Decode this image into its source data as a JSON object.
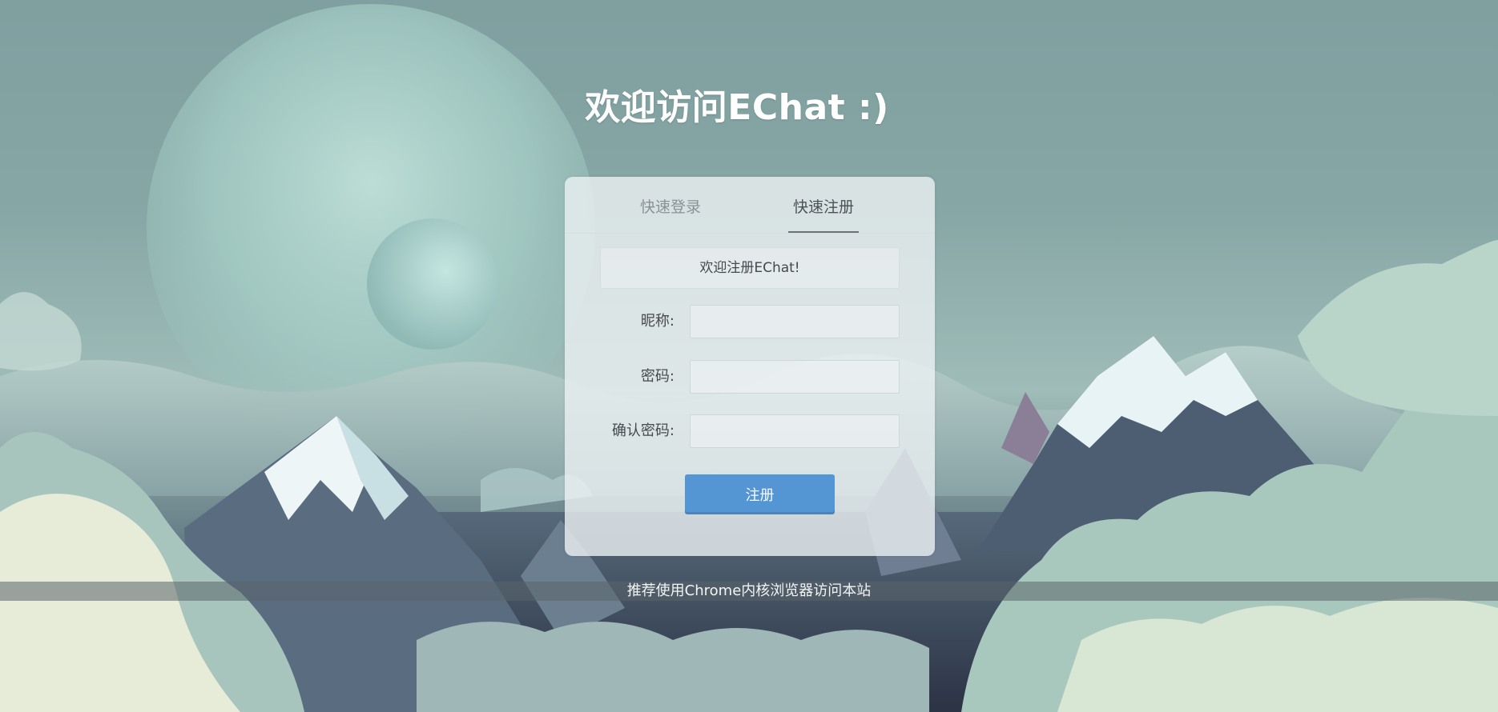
{
  "page": {
    "title": "欢迎访问EChat :)",
    "footer": "推荐使用Chrome内核浏览器访问本站"
  },
  "tabs": [
    {
      "label": "快速登录",
      "active": false
    },
    {
      "label": "快速注册",
      "active": true
    }
  ],
  "register": {
    "notice": "欢迎注册EChat!",
    "fields": {
      "nickname": {
        "label": "昵称:",
        "value": ""
      },
      "password": {
        "label": "密码:",
        "value": ""
      },
      "confirm": {
        "label": "确认密码:",
        "value": ""
      }
    },
    "submit_label": "注册"
  },
  "colors": {
    "accent": "#4a8fd3",
    "title_text": "#ffffff"
  }
}
